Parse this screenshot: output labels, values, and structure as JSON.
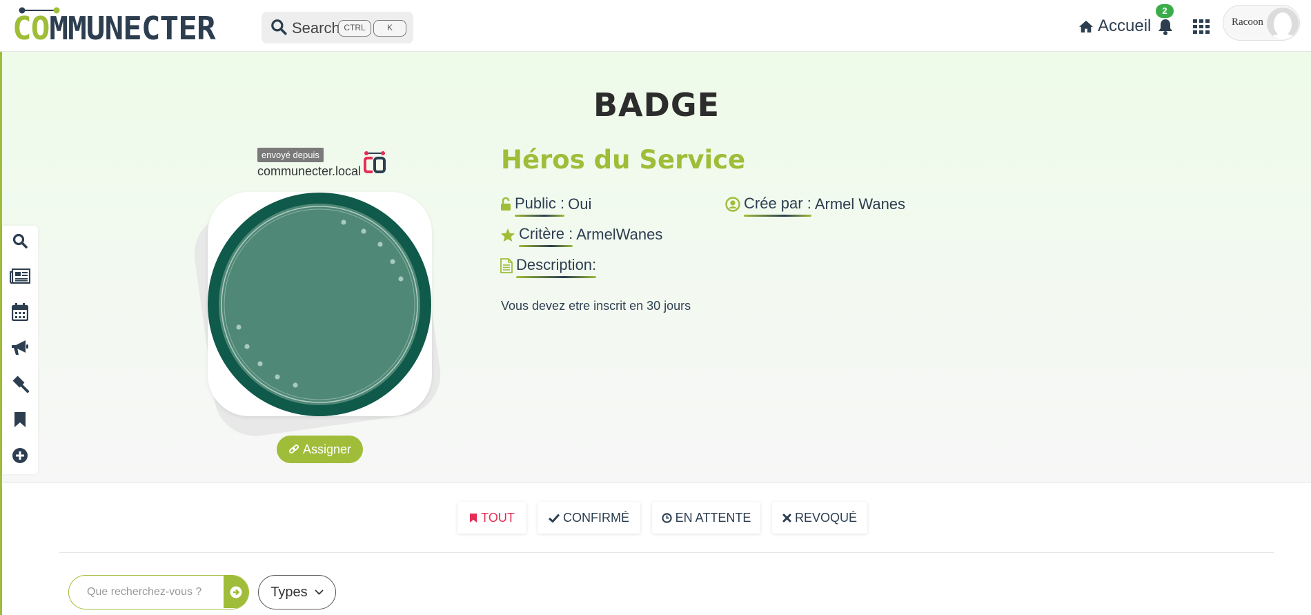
{
  "header": {
    "logo_text": "COMMUNECTER",
    "search_label": "Search",
    "search_kbd_1": "CTRL",
    "search_kbd_2": "K",
    "home_label": "Accueil",
    "notification_count": "2",
    "user_name": "Racoon"
  },
  "side_menu": [
    {
      "icon": "search-icon"
    },
    {
      "icon": "newspaper-icon"
    },
    {
      "icon": "calendar-icon"
    },
    {
      "icon": "megaphone-icon"
    },
    {
      "icon": "gavel-icon"
    },
    {
      "icon": "bookmark-icon"
    },
    {
      "icon": "plus-circle-icon"
    }
  ],
  "page": {
    "title": "BADGE",
    "sent_from_label": "envoyé depuis",
    "source_host": "communecter.local",
    "assign_label": "Assigner"
  },
  "badge": {
    "name": "Héros du Service",
    "public_key": "Public :",
    "public_value": "Oui",
    "creator_key": "Crée par :",
    "creator_value": "Armel Wanes",
    "criteria_key": "Critère :",
    "criteria_value": "ArmelWanes",
    "description_key": "Description:",
    "description_value": "Vous devez etre inscrit en 30 jours",
    "image_colors": {
      "ring": "#0f5a4a",
      "inner": "#4f8876"
    }
  },
  "filters": {
    "all": "TOUT",
    "confirmed": "CONFIRMÉ",
    "pending": "EN ATTENTE",
    "revoked": "REVOQUÉ"
  },
  "search": {
    "placeholder": "Que recherchez-vous ?",
    "types_label": "Types"
  },
  "colors": {
    "accent": "#9fbd38",
    "dark": "#2c3e50",
    "active_filter": "#e52d54"
  }
}
